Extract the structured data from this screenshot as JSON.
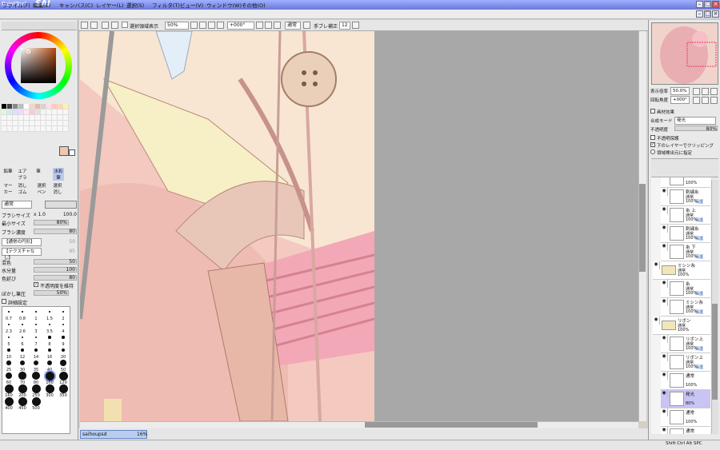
{
  "window": {
    "app_name": "PaintTool",
    "logo": "SAI"
  },
  "menu": [
    "ファイル(F)",
    "編集(E)",
    "キャンバス(C)",
    "レイヤー(L)",
    "選択(S)",
    "フィルタ(T)",
    "ビュー(V)",
    "ウィンドウ(W)",
    "その他(O)"
  ],
  "toolbar": {
    "selection_show_label": "選択領域表示",
    "zoom": "50%",
    "rotation": "+000°",
    "mode": "通常",
    "stabilizer_label": "手ブレ補正",
    "stabilizer_value": "12"
  },
  "tools": {
    "row1": [
      "鉛筆",
      "エアブラ",
      "筆",
      "水彩筆"
    ],
    "row2": [
      "マーカー",
      "消しゴム",
      "選択ペン",
      "選択消し"
    ]
  },
  "brush": {
    "mode": "通常",
    "size_label": "ブラシサイズ",
    "size_multiplier": "x 1.0",
    "size_value": "100.0",
    "min_size_label": "最小サイズ",
    "min_size_value": "80%",
    "density_label": "ブラシ濃度",
    "density_value": "80",
    "shape": "【通常の円形】",
    "shape_strength": "50",
    "texture": "【テクスチャなし】",
    "texture_strength": "95",
    "blend_label": "混色",
    "blend_value": "50",
    "water_label": "水分量",
    "water_value": "100",
    "persistence_label": "色延び",
    "persistence_value": "80",
    "keep_opacity_label": "不透明度を維持",
    "blur_label": "ぼかし筆圧",
    "blur_value": "50%",
    "advanced_label": "詳細設定"
  },
  "brush_sizes": [
    "0.7",
    "0.8",
    "1",
    "1.5",
    "2",
    "2.3",
    "2.6",
    "3",
    "3.5",
    "4",
    "5",
    "6",
    "7",
    "8",
    "9",
    "10",
    "12",
    "14",
    "16",
    "20",
    "25",
    "30",
    "35",
    "40",
    "50",
    "60",
    "70",
    "80",
    "100",
    "120",
    "160",
    "200",
    "250",
    "300",
    "350",
    "400",
    "450",
    "500"
  ],
  "selected_brush_size": "100",
  "navigator": {
    "zoom_label": "表示倍率",
    "zoom_value": "50.0%",
    "rotate_label": "回転角度",
    "rotate_value": "+000°"
  },
  "layer_props": {
    "effect_label": "画材効果",
    "blend_label": "合成モード",
    "blend_value": "発光",
    "opacity_label": "不透明度",
    "opacity_value": "80%",
    "protect_opacity": "不透明保護",
    "clip_below": "下のレイヤーでクリッピング",
    "selection_source": "領域検出元に指定"
  },
  "layers": [
    {
      "name": "通常",
      "mode": "",
      "opacity": "100%",
      "protect": "",
      "folder": false
    },
    {
      "name": "刺繍糸",
      "mode": "通常",
      "opacity": "100%",
      "protect": "保護",
      "folder": false
    },
    {
      "name": "糸 上",
      "mode": "通常",
      "opacity": "100%",
      "protect": "保護",
      "folder": false
    },
    {
      "name": "刺繍糸",
      "mode": "通常",
      "opacity": "100%",
      "protect": "保護",
      "folder": false
    },
    {
      "name": "糸 下",
      "mode": "通常",
      "opacity": "100%",
      "protect": "保護",
      "folder": false
    },
    {
      "name": "ミシン糸",
      "mode": "通常",
      "opacity": "100%",
      "protect": "",
      "folder": true
    },
    {
      "name": "糸",
      "mode": "通常",
      "opacity": "100%",
      "protect": "保護",
      "folder": false
    },
    {
      "name": "ミシン糸",
      "mode": "通常",
      "opacity": "100%",
      "protect": "保護",
      "folder": false
    },
    {
      "name": "リボン",
      "mode": "通常",
      "opacity": "100%",
      "protect": "",
      "folder": true
    },
    {
      "name": "リボン上",
      "mode": "通常",
      "opacity": "100%",
      "protect": "保護",
      "folder": false
    },
    {
      "name": "リボン上",
      "mode": "通常",
      "opacity": "100%",
      "protect": "保護",
      "folder": false
    },
    {
      "name": "通常",
      "mode": "",
      "opacity": "100%",
      "protect": "",
      "folder": false
    },
    {
      "name": "発光",
      "mode": "",
      "opacity": "80%",
      "protect": "",
      "folder": false,
      "selected": true
    },
    {
      "name": "通常",
      "mode": "",
      "opacity": "100%",
      "protect": "",
      "folder": false
    },
    {
      "name": "通常",
      "mode": "",
      "opacity": "100%",
      "protect": "",
      "folder": false
    },
    {
      "name": "リボン",
      "mode": "通常",
      "opacity": "100%",
      "protect": "保護",
      "folder": false
    }
  ],
  "document_tab": {
    "name": "saihoupsd",
    "zoom": "16%"
  },
  "status": {
    "keys": "Shift Ctrl Alt SPC"
  }
}
